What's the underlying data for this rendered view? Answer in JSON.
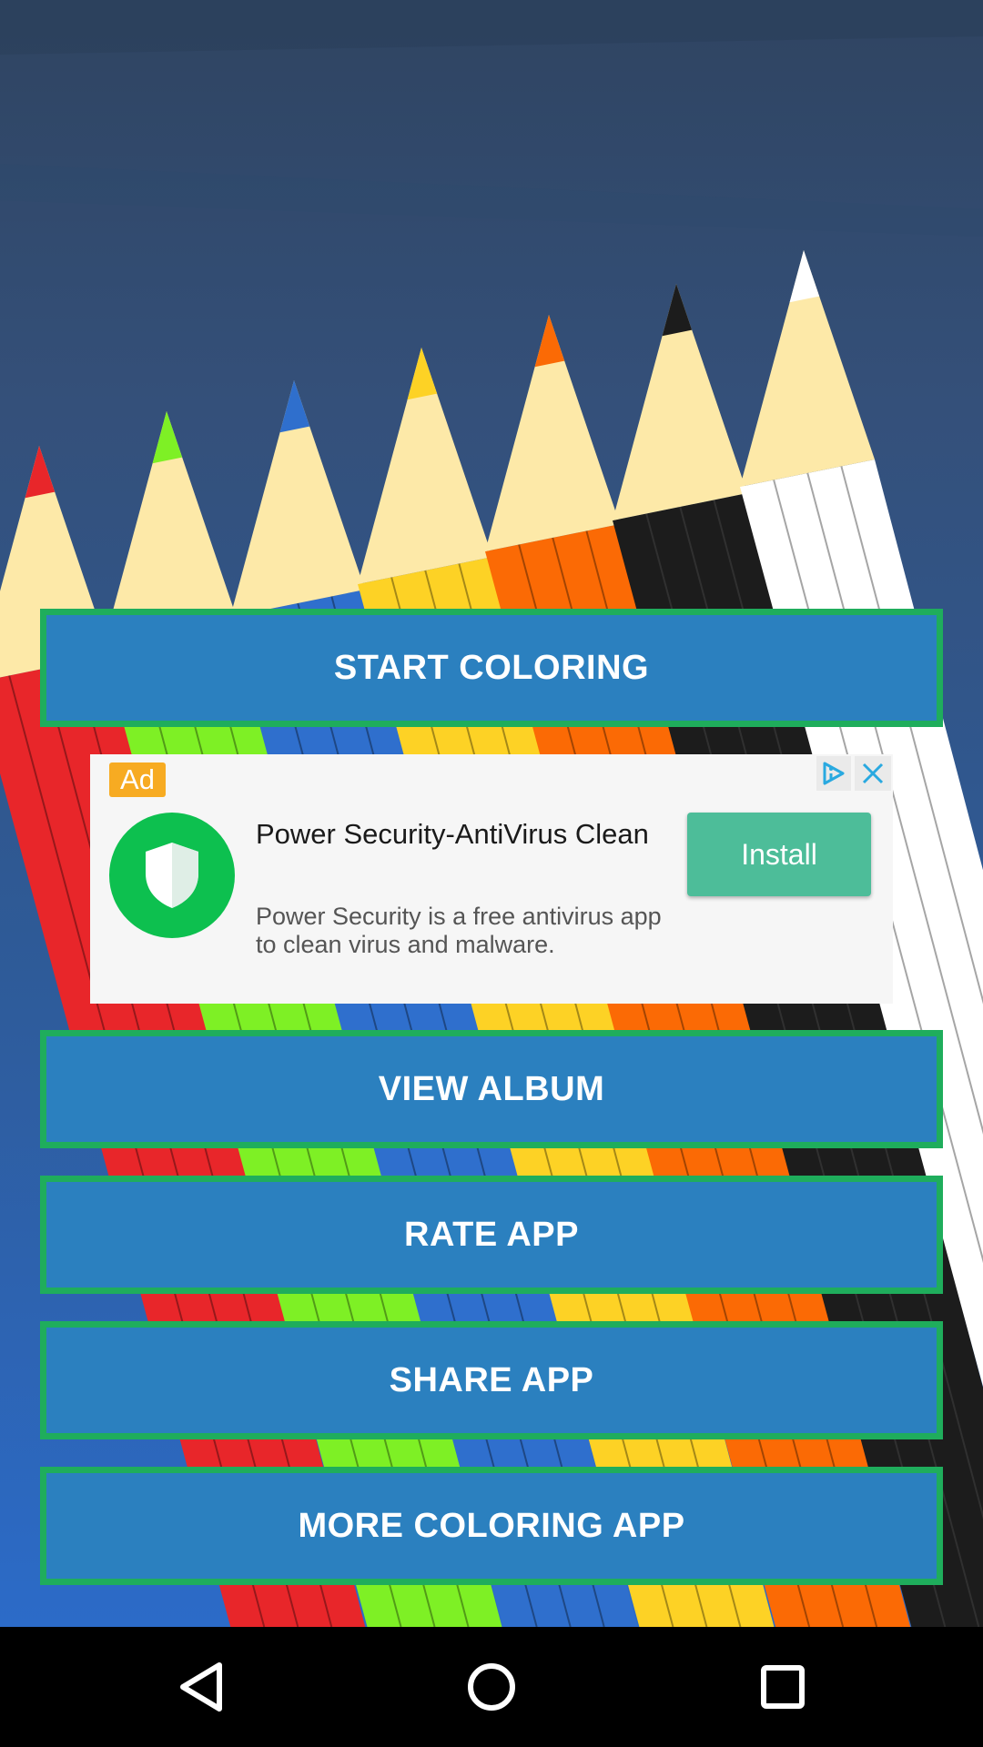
{
  "menu": {
    "start_coloring": "START COLORING",
    "view_album": "VIEW ALBUM",
    "rate_app": "RATE APP",
    "share_app": "SHARE APP",
    "more_coloring_app": "MORE COLORING APP"
  },
  "ad": {
    "badge": "Ad",
    "title": "Power Security-AntiVirus Clean",
    "description": "Power Security is a free antivirus app to clean virus and malware.",
    "install_label": "Install",
    "choices_icon": "adchoices-icon",
    "close_icon": "close-icon",
    "logo_icon": "shield-icon"
  },
  "navbar": {
    "back_icon": "back-triangle-icon",
    "home_icon": "home-circle-icon",
    "recents_icon": "recents-square-icon"
  },
  "colors": {
    "button_bg": "#2b80bf",
    "button_border": "#1fad5c",
    "ad_badge": "#f7ab22",
    "install_bg": "#4dbd99",
    "pencils": [
      "#e8262a",
      "#7ef025",
      "#2f6fcd",
      "#fdd225",
      "#fb6a05",
      "#1c1c1c",
      "#ffffff"
    ]
  }
}
